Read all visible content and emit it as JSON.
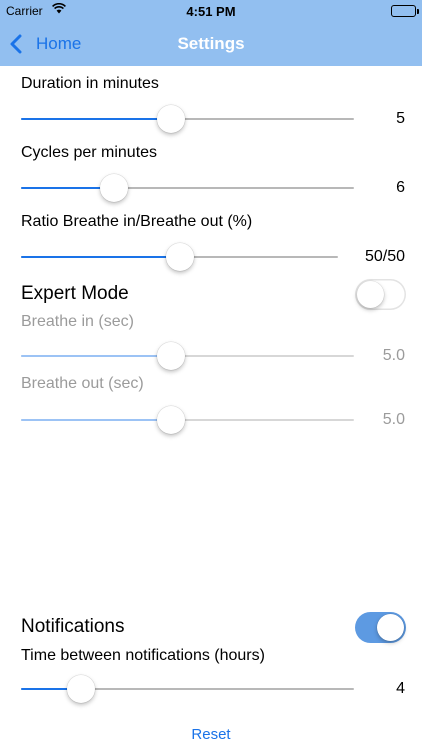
{
  "status_bar": {
    "carrier": "Carrier",
    "time": "4:51 PM",
    "wifi_icon": "wifi-icon",
    "battery_icon": "battery-icon"
  },
  "nav": {
    "back_label": "Home",
    "title": "Settings",
    "back_icon": "chevron-left-icon"
  },
  "settings": {
    "duration": {
      "label": "Duration in minutes",
      "value": "5",
      "slider_fraction": 0.45
    },
    "cycles": {
      "label": "Cycles per minutes",
      "value": "6",
      "slider_fraction": 0.28
    },
    "ratio": {
      "label": "Ratio Breathe in/Breathe out (%)",
      "value": "50/50",
      "slider_fraction": 0.5
    },
    "expert_mode": {
      "label": "Expert Mode",
      "enabled": false
    },
    "breathe_in": {
      "label": "Breathe in (sec)",
      "value": "5.0",
      "slider_fraction": 0.45,
      "disabled": true
    },
    "breathe_out": {
      "label": "Breathe out (sec)",
      "value": "5.0",
      "slider_fraction": 0.45,
      "disabled": true
    },
    "notifications": {
      "label": "Notifications",
      "enabled": true
    },
    "notification_interval": {
      "label": "Time between notifications (hours)",
      "value": "4",
      "slider_fraction": 0.18
    }
  },
  "reset_label": "Reset",
  "colors": {
    "accent": "#1a73e8",
    "nav_bar": "#92bff0",
    "toggle_on": "#5d9ae2"
  }
}
